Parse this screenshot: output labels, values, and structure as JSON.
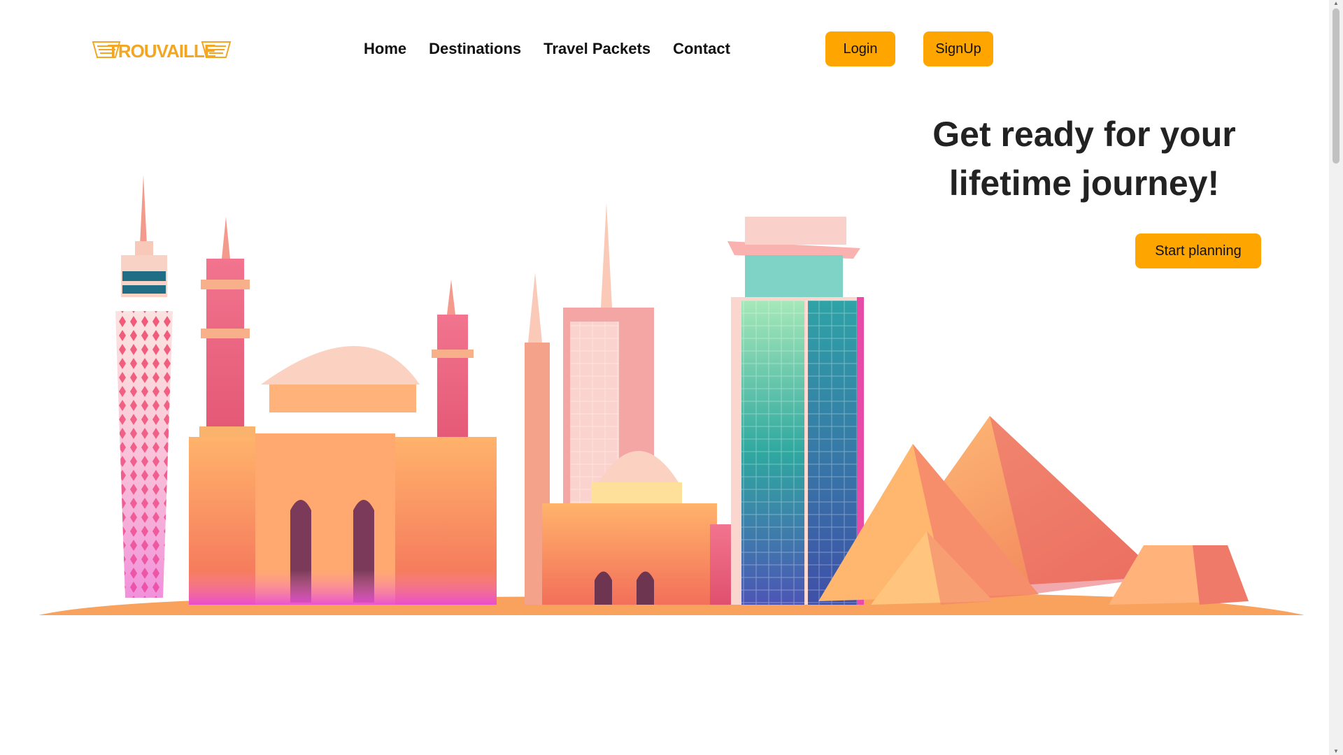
{
  "brand": {
    "name": "TROUVAILLE",
    "color": "#F2A623"
  },
  "nav": {
    "items": [
      {
        "label": "Home"
      },
      {
        "label": "Destinations"
      },
      {
        "label": "Travel Packets"
      },
      {
        "label": "Contact"
      }
    ]
  },
  "auth": {
    "login_label": "Login",
    "signup_label": "SignUp"
  },
  "hero": {
    "title_line1": "Get ready for your",
    "title_line2": "lifetime journey!",
    "cta_label": "Start planning"
  },
  "colors": {
    "accent": "#FFA500",
    "text": "#111111"
  },
  "icons": {
    "scroll_up": "chevron-up-icon",
    "scroll_down": "chevron-down-icon"
  }
}
